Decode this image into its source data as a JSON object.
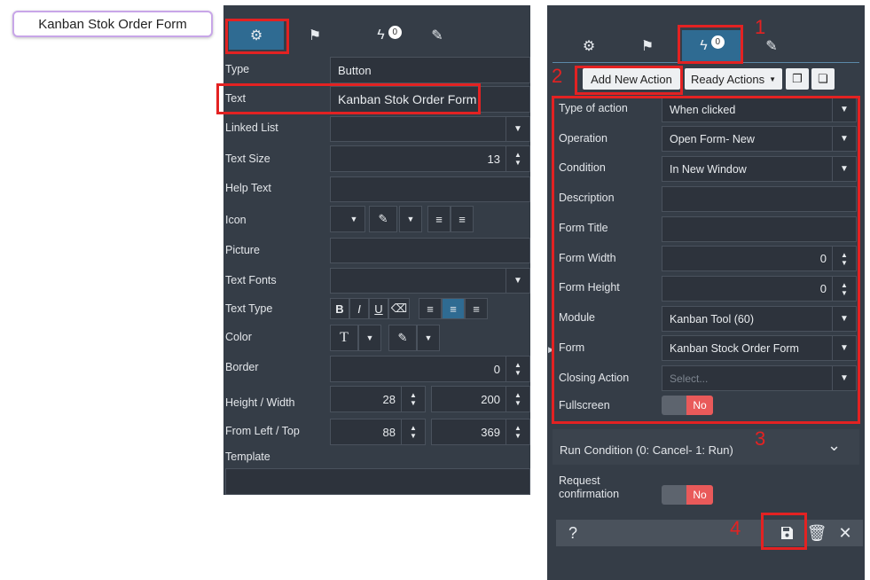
{
  "canvas_button": {
    "label": "Kanban Stok Order Form"
  },
  "left_panel": {
    "tabs": [
      {
        "icon": "gear-icon",
        "glyph": "⚙"
      },
      {
        "icon": "flag-icon",
        "glyph": "⚑"
      },
      {
        "icon": "lightning-icon",
        "glyph": "ϟ",
        "badge": "0"
      },
      {
        "icon": "brush-icon",
        "glyph": "✎"
      }
    ],
    "rows": {
      "type_label": "Type",
      "type_value": "Button",
      "text_label": "Text",
      "text_value": "Kanban Stok Order Form",
      "linked_list_label": "Linked List",
      "text_size_label": "Text Size",
      "text_size_value": "13",
      "help_text_label": "Help Text",
      "icon_label": "Icon",
      "picture_label": "Picture",
      "text_fonts_label": "Text Fonts",
      "text_type_label": "Text Type",
      "color_label": "Color",
      "border_label": "Border",
      "border_value": "0",
      "height_width_label": "Height / Width",
      "height_value": "28",
      "width_value": "200",
      "from_left_top_label": "From Left / Top",
      "left_value": "88",
      "top_value": "369",
      "template_label": "Template"
    }
  },
  "right_panel": {
    "add_new_action": "Add New Action",
    "ready_actions": "Ready Actions",
    "rows": {
      "type_of_action_label": "Type of action",
      "type_of_action_value": "When clicked",
      "operation_label": "Operation",
      "operation_value": "Open Form- New",
      "condition_label": "Condition",
      "condition_value": "In New Window",
      "description_label": "Description",
      "form_title_label": "Form Title",
      "form_width_label": "Form Width",
      "form_width_value": "0",
      "form_height_label": "Form Height",
      "form_height_value": "0",
      "module_label": "Module",
      "module_value": "Kanban Tool (60)",
      "form_label": "Form",
      "form_value": "Kanban Stock Order Form",
      "closing_action_label": "Closing Action",
      "closing_action_placeholder": "Select...",
      "fullscreen_label": "Fullscreen",
      "fullscreen_value": "No",
      "run_condition_label": "Run Condition (0: Cancel- 1: Run)",
      "request_confirmation_label": "Request confirmation",
      "request_confirmation_value": "No"
    },
    "help": "?"
  },
  "annotations": {
    "n1": "1",
    "n2": "2",
    "n3": "3",
    "n4": "4"
  },
  "colors": {
    "panel_bg": "#353d47",
    "active_tab": "#2f6b92",
    "annotation_red": "#e32222",
    "toggle_no": "#e95a5a"
  }
}
